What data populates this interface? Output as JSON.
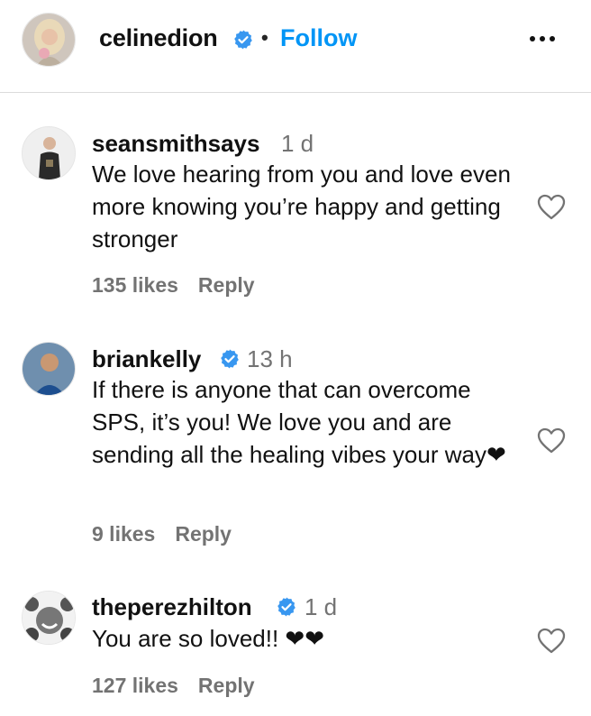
{
  "post_header": {
    "username": "celinedion",
    "separator": "•",
    "follow_label": "Follow",
    "more_icon": "more-horizontal-icon"
  },
  "comments": [
    {
      "username": "seansmithsays",
      "verified": false,
      "time": "1 d",
      "text": "We love hearing from you and love even more knowing you’re happy and getting stronger",
      "likes": "135 likes",
      "reply_label": "Reply"
    },
    {
      "username": "briankelly",
      "verified": true,
      "time": "13 h",
      "text": "If there is anyone that can overcome SPS, it’s you! We love you and are sending all the healing vibes your way❤",
      "likes": "9 likes",
      "reply_label": "Reply"
    },
    {
      "username": "theperezhilton",
      "verified": true,
      "time": "1 d",
      "text": "You are so loved!! ❤❤",
      "likes": "127 likes",
      "reply_label": "Reply"
    }
  ],
  "colors": {
    "link_blue": "#0095f6",
    "verified_blue": "#3897f0",
    "muted_text": "#737373"
  }
}
